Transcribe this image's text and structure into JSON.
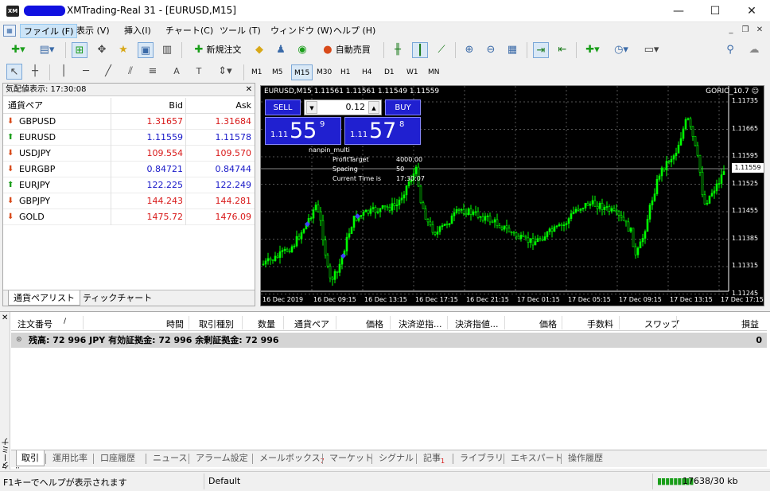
{
  "window": {
    "title": "XMTrading-Real 31 - [EURUSD,M15]",
    "app_icon_text": "XM",
    "minimize": "—",
    "maximize": "☐",
    "close": "✕"
  },
  "menu": [
    {
      "label": "ファイル (F)",
      "active": true
    },
    {
      "label": "表示 (V)"
    },
    {
      "label": "挿入(I)"
    },
    {
      "label": "チャート(C)"
    },
    {
      "label": "ツール (T)"
    },
    {
      "label": "ウィンドウ (W)"
    },
    {
      "label": "ヘルプ (H)"
    }
  ],
  "toolbar": {
    "new_order": "新規注文",
    "auto_trading": "自動売買"
  },
  "timeframes": [
    "M1",
    "M5",
    "M15",
    "M30",
    "H1",
    "H4",
    "D1",
    "W1",
    "MN"
  ],
  "timeframe_selected": "M15",
  "market_watch": {
    "header": "気配値表示: 17:30:08",
    "col_symbol": "通貨ペア",
    "col_bid": "Bid",
    "col_ask": "Ask",
    "rows": [
      {
        "symbol": "GBPUSD",
        "bid": "1.31657",
        "ask": "1.31684",
        "dir": "down",
        "color": "red"
      },
      {
        "symbol": "EURUSD",
        "bid": "1.11559",
        "ask": "1.11578",
        "dir": "up",
        "color": "blue"
      },
      {
        "symbol": "USDJPY",
        "bid": "109.554",
        "ask": "109.570",
        "dir": "down",
        "color": "red"
      },
      {
        "symbol": "EURGBP",
        "bid": "0.84721",
        "ask": "0.84744",
        "dir": "down",
        "color": "blue"
      },
      {
        "symbol": "EURJPY",
        "bid": "122.225",
        "ask": "122.249",
        "dir": "up",
        "color": "blue"
      },
      {
        "symbol": "GBPJPY",
        "bid": "144.243",
        "ask": "144.281",
        "dir": "down",
        "color": "red"
      },
      {
        "symbol": "GOLD",
        "bid": "1475.72",
        "ask": "1476.09",
        "dir": "down",
        "color": "red"
      }
    ],
    "tabs": [
      "通貨ペアリスト",
      "ティックチャート"
    ]
  },
  "chart": {
    "title": "EURUSD,M15  1.11561 1.11561 1.11549 1.11559",
    "ea_name": "GORIO_10.7",
    "sell_label": "SELL",
    "buy_label": "BUY",
    "lot": "0.12",
    "sell_price": {
      "prefix": "1.11",
      "big": "55",
      "sup": "9"
    },
    "buy_price": {
      "prefix": "1.11",
      "big": "57",
      "sup": "8"
    },
    "ea_info": {
      "name": "nanpin_multi",
      "profit_target_label": "ProfitTarget",
      "profit_target_value": "4000.00",
      "spacing_label": "Spacing",
      "spacing_value": "50",
      "time_label": "Current Time is",
      "time_value": "17:30:07"
    },
    "current_price": "1.11559",
    "price_labels": [
      "1.11735",
      "1.11665",
      "1.11595",
      "1.11525",
      "1.11455",
      "1.11385",
      "1.11315",
      "1.11245"
    ],
    "time_labels": [
      "16 Dec 2019",
      "16 Dec 09:15",
      "16 Dec 13:15",
      "16 Dec 17:15",
      "16 Dec 21:15",
      "17 Dec 01:15",
      "17 Dec 05:15",
      "17 Dec 09:15",
      "17 Dec 13:15",
      "17 Dec 17:15"
    ],
    "candle_color": "#00ff00",
    "background": "#000000"
  },
  "terminal": {
    "side_label": "ターミナル",
    "columns": [
      "注文番号",
      "/",
      "時間",
      "取引種別",
      "数量",
      "通貨ペア",
      "価格",
      "決済逆指...",
      "決済指値...",
      "価格",
      "手数料",
      "スワップ",
      "損益"
    ],
    "balance_text": "残高: 72 996 JPY  有効証拠金: 72 996  余剰証拠金: 72 996",
    "balance_value": "0",
    "tabs": [
      {
        "label": "取引",
        "active": true
      },
      {
        "label": "運用比率"
      },
      {
        "label": "口座履歴"
      },
      {
        "label": "ニュース"
      },
      {
        "label": "アラーム設定"
      },
      {
        "label": "メールボックス",
        "badge": "7"
      },
      {
        "label": "マーケット"
      },
      {
        "label": "シグナル"
      },
      {
        "label": "記事",
        "badge": "1"
      },
      {
        "label": "ライブラリ"
      },
      {
        "label": "エキスパート"
      },
      {
        "label": "操作履歴"
      }
    ]
  },
  "status": {
    "help": "F1キーでヘルプが表示されます",
    "profile": "Default",
    "traffic": "17638/30 kb"
  }
}
